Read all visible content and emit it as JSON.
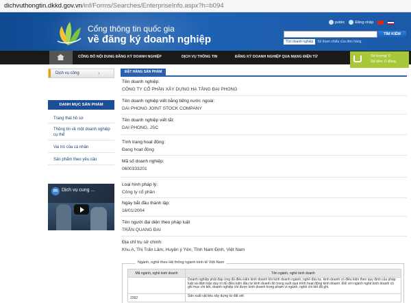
{
  "browser": {
    "url_host": "dichvuthongtin.dkkd.gov.vn",
    "url_path": "/inf/Forms/Searches/EnterpriseInfo.aspx?h=b094"
  },
  "header": {
    "title_line1": "Cổng thông tin quốc gia",
    "title_line2": "về đăng ký doanh nghiệp",
    "link_public": "public",
    "link_login": "Đăng nhập",
    "search_button": "TÌM KIẾM",
    "search_tab_active": "Tìm doanh nghiệp",
    "search_tab_other": "Số tham chiếu của đơn hàng"
  },
  "nav": {
    "items": [
      "CÔNG BỐ NỘI DUNG ĐĂNG KÝ DOANH NGHIỆP",
      "DỊCH VỤ THÔNG TIN",
      "ĐĂNG KÝ DOANH NGHIỆP QUA MẠNG ĐIỆN TỬ"
    ]
  },
  "cart": {
    "quantity": "Số lượng: 0",
    "amount": "Số tiền: 0 đồng"
  },
  "sidebar": {
    "service_label": "Dịch vụ công",
    "heading": "DANH MỤC SẢN PHẨM",
    "items": [
      "Trang thái hồ sơ",
      "Thông tin về một doanh nghiệp cụ thể",
      "Vai trò của cá nhân",
      "Sản phẩm theo yêu cầu"
    ],
    "video_avatar": "m",
    "video_title": "Dịch vụ cung ..."
  },
  "main": {
    "order_tag": "ĐẶT HÀNG SẢN PHẨM",
    "fields": [
      {
        "label": "Tên doanh nghiệp:",
        "value": "CÔNG TY CỔ PHẦN XÂY DỰNG HẠ TẦNG ĐẠI PHONG"
      },
      {
        "label": "Tên doanh nghiệp viết bằng tiếng nước ngoài:",
        "value": "DAI PHONG JOINT STOCK COMPANY"
      },
      {
        "label": "Tên doanh nghiệp viết tắt:",
        "value": "DAI PHONG, JSC"
      },
      {
        "label": "Tình trạng hoạt động:",
        "value": "Đang hoạt động"
      },
      {
        "label": "Mã số doanh nghiệp:",
        "value": "0600333201"
      },
      {
        "label": "Loại hình pháp lý:",
        "value": "Công ty cổ phần"
      },
      {
        "label": "Ngày bắt đầu thành lập:",
        "value": "16/01/2004"
      },
      {
        "label": "Tên người đại diện theo pháp luật",
        "value": "TRẦN QUANG ĐẠI"
      },
      {
        "label": "Địa chỉ trụ sở chính:",
        "value": "Khu A, Thị Trấn Lâm, Huyện ý Yên, Tỉnh Nam Định, Việt Nam"
      }
    ]
  },
  "industry": {
    "legend": "Ngành, nghề theo Hệ thống ngành kinh tế Việt Nam",
    "col_code": "Mã ngành, nghề kinh doanh",
    "col_name": "Tên ngành, nghề kinh doanh",
    "note": "Doanh nghiệp phải đáp ứng đủ điều kiện kinh doanh khi kinh doanh ngành, nghề đầu tư, kinh doanh có điều kiện theo quy định của pháp luật và đảm bảo duy trì đủ điều kiện đầu tư kinh doanh đó trong suốt quá trình hoạt động kinh doanh. Đối với ngành nghề kinh doanh có ghi mục chi tiết, doanh nghiệp chỉ được kinh doanh trong phạm vi ngành, nghề chi tiết đã ghi.",
    "row_code": "2392",
    "row_name": "Sản xuất vật liệu xây dựng từ đất sét"
  }
}
